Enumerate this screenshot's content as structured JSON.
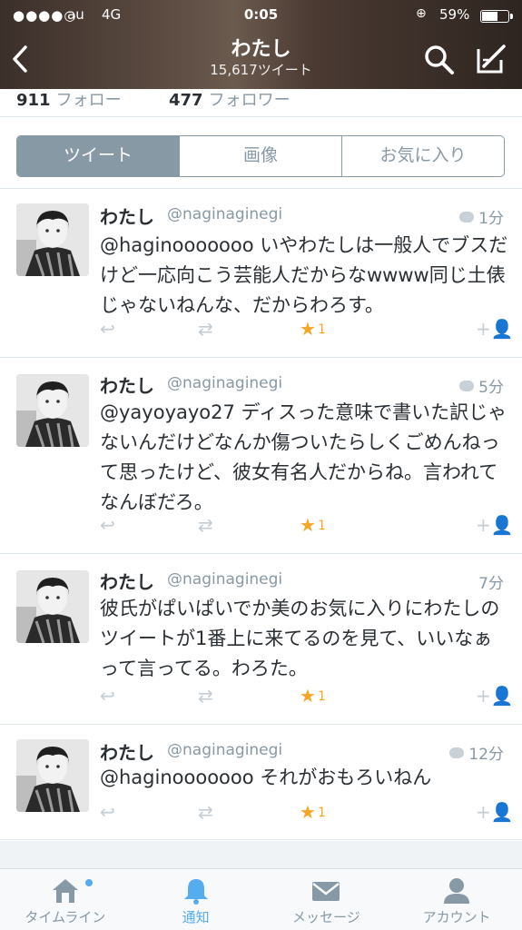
{
  "status_bar": {
    "signal": "●●●●○",
    "carrier": "au",
    "network": "4G",
    "time": "0:05",
    "battery": "59%"
  },
  "header": {
    "title": "わたし",
    "subtitle": "15,617ツイート"
  },
  "stats": {
    "following_count": "911",
    "following_label": "フォロー",
    "followers_count": "477",
    "followers_label": "フォロワー"
  },
  "segments": [
    "ツイート",
    "画像",
    "お気に入り"
  ],
  "tweets": [
    {
      "name": "わたし",
      "handle": "@naginaginegi",
      "time": "1分",
      "text": "@haginooooooo いやわたしは一般人でブスだけど一応向こう芸能人だからなwwww同じ土俵じゃないねんな、だからわろす。",
      "fav_count": "1"
    },
    {
      "name": "わたし",
      "handle": "@naginaginegi",
      "time": "5分",
      "text": "@yayoyayo27 ディスった意味で書いた訳じゃないんだけどなんか傷ついたらしくごめんねって思ったけど、彼女有名人だからね。言われてなんぼだろ。",
      "fav_count": "1"
    },
    {
      "name": "わたし",
      "handle": "@naginaginegi",
      "time": "7分",
      "text": "彼氏がぱいぱいでか美のお気に入りにわたしのツイートが1番上に来てるのを見て、いいなぁって言ってる。わろた。",
      "fav_count": "1"
    },
    {
      "name": "わたし",
      "handle": "@naginaginegi",
      "time": "12分",
      "text": "@haginooooooo それがおもろいねん",
      "fav_count": "1"
    }
  ],
  "tabbar": {
    "timeline": "タイムライン",
    "notifications": "通知",
    "messages": "メッセージ",
    "account": "アカウント"
  },
  "colors": {
    "accent": "#55acee",
    "muted": "#8899a6",
    "favorite": "#f5a623"
  }
}
